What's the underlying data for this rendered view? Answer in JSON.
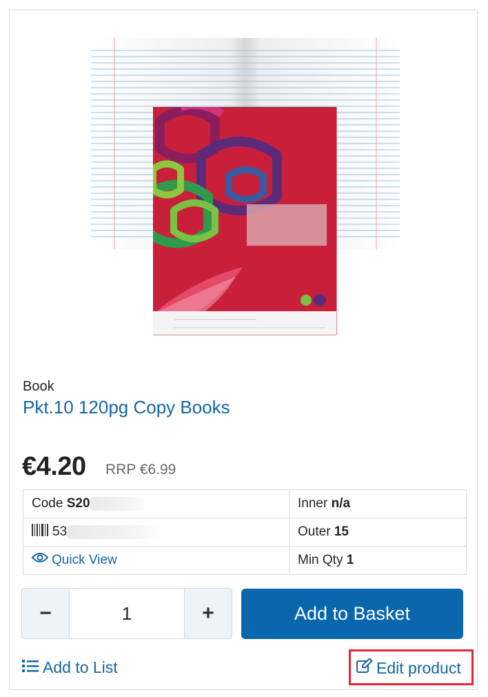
{
  "product": {
    "category": "Book",
    "title": "Pkt.10 120pg Copy Books",
    "price": "€4.20",
    "rrp": "RRP €6.99"
  },
  "details": {
    "code_label": "Code",
    "code_value": "S20",
    "barcode_value": "53",
    "quick_view_label": "Quick View",
    "inner_label": "Inner",
    "inner_value": "n/a",
    "outer_label": "Outer",
    "outer_value": "15",
    "min_qty_label": "Min Qty",
    "min_qty_value": "1"
  },
  "quantity": {
    "minus_label": "−",
    "value": "1",
    "plus_label": "+"
  },
  "actions": {
    "add_to_basket": "Add to Basket",
    "add_to_list": "Add to List",
    "edit_product": "Edit product"
  },
  "colors": {
    "accent": "#1366a6",
    "basket_button": "#0a66ad",
    "highlight": "#e8203a",
    "cover_red": "#c8203a"
  },
  "icons": {
    "barcode": "barcode-icon",
    "quick_view": "eye-icon",
    "add_to_list": "list-icon",
    "edit_product": "edit-icon"
  }
}
